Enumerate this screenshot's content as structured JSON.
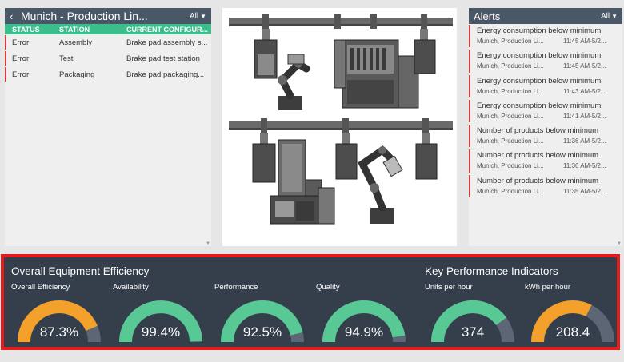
{
  "station_panel": {
    "title": "Munich - Production Lin...",
    "filter": "All",
    "columns": [
      "STATUS",
      "STATION",
      "CURRENT CONFIGUR..."
    ],
    "rows": [
      {
        "status": "Error",
        "station": "Assembly",
        "config": "Brake pad assembly s..."
      },
      {
        "status": "Error",
        "station": "Test",
        "config": "Brake pad test station"
      },
      {
        "status": "Error",
        "station": "Packaging",
        "config": "Brake pad packaging..."
      }
    ]
  },
  "alerts": {
    "title": "Alerts",
    "filter": "All",
    "items": [
      {
        "message": "Energy consumption below minimum",
        "location": "Munich, Production Li...",
        "time": "11:45 AM-5/2..."
      },
      {
        "message": "Energy consumption below minimum",
        "location": "Munich, Production Li...",
        "time": "11:45 AM-5/2..."
      },
      {
        "message": "Energy consumption below minimum",
        "location": "Munich, Production Li...",
        "time": "11:43 AM-5/2..."
      },
      {
        "message": "Energy consumption below minimum",
        "location": "Munich, Production Li...",
        "time": "11:41 AM-5/2..."
      },
      {
        "message": "Number of products below minimum",
        "location": "Munich, Production Li...",
        "time": "11:36 AM-5/2..."
      },
      {
        "message": "Number of products below minimum",
        "location": "Munich, Production Li...",
        "time": "11:36 AM-5/2..."
      },
      {
        "message": "Number of products below minimum",
        "location": "Munich, Production Li...",
        "time": "11:35 AM-5/2..."
      }
    ]
  },
  "kpi": {
    "oee_title": "Overall Equipment Efficiency",
    "kpi_title": "Key Performance Indicators",
    "colors": {
      "orange": "#f4a12b",
      "green": "#58c995",
      "track": "#5c6675",
      "band": "#343f4b",
      "alert": "#d43c3c"
    },
    "gauges": [
      {
        "label": "Overall Efficiency",
        "value": "87.3%",
        "fill": 0.873,
        "color": "orange"
      },
      {
        "label": "Availability",
        "value": "99.4%",
        "fill": 0.994,
        "color": "green"
      },
      {
        "label": "Performance",
        "value": "92.5%",
        "fill": 0.925,
        "color": "green"
      },
      {
        "label": "Quality",
        "value": "94.9%",
        "fill": 0.949,
        "color": "green"
      },
      {
        "label": "Units per hour",
        "value": "374",
        "fill": 0.8,
        "color": "green"
      },
      {
        "label": "kWh per hour",
        "value": "208.4",
        "fill": 0.65,
        "color": "orange"
      }
    ]
  }
}
